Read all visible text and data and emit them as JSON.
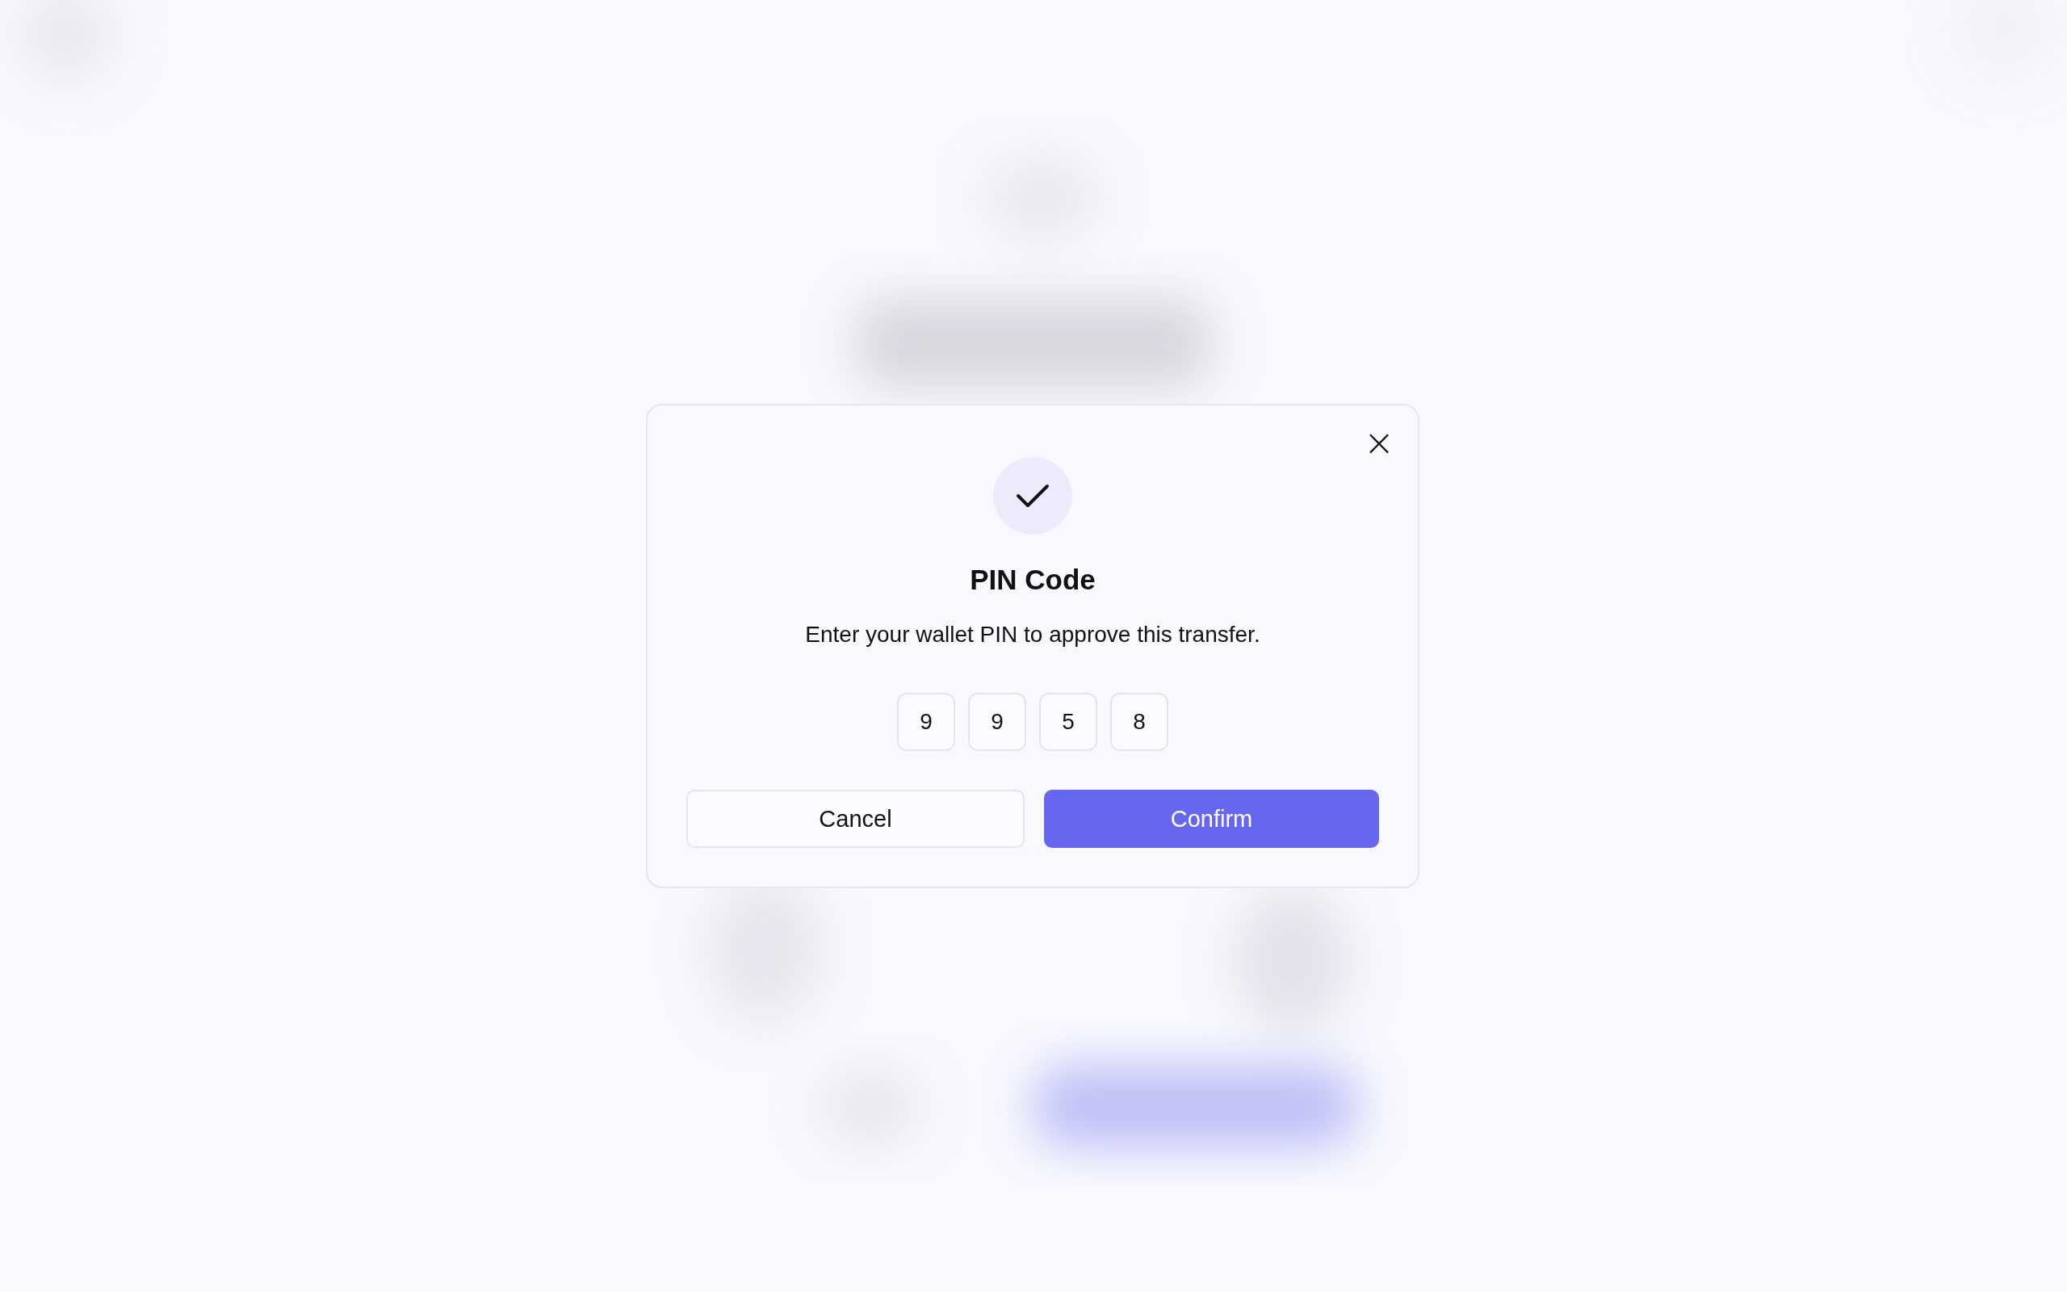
{
  "dialog": {
    "title": "PIN Code",
    "message": "Enter your wallet PIN to approve this transfer.",
    "close": "×",
    "pin": [
      "9",
      "9",
      "5",
      "8"
    ],
    "buttons": [
      {
        "label": "Cancel",
        "kind": "secondary"
      },
      {
        "label": "Confirm",
        "kind": "primary"
      }
    ]
  }
}
